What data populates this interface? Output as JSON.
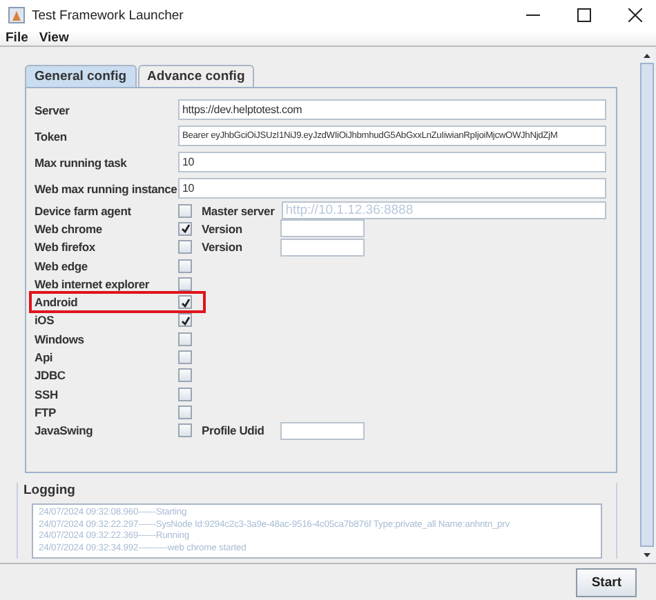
{
  "window": {
    "title": "Test Framework Launcher"
  },
  "menu": [
    "File",
    "View"
  ],
  "tabs": [
    {
      "label": "General config",
      "selected": true
    },
    {
      "label": "Advance config",
      "selected": false
    }
  ],
  "rows": [
    {
      "kind": "text",
      "label": "Server",
      "value": "https://dev.helptotest.com"
    },
    {
      "kind": "text",
      "label": "Token",
      "value": "Bearer eyJhbGciOiJSUzI1NiJ9.eyJzdWIiOiJhbmhudG5AbGxxLnZuIiwianRpIjoiMjcwOWJhNjdZjM"
    },
    {
      "kind": "text",
      "label": "Max running task",
      "value": "10"
    },
    {
      "kind": "text",
      "label": "Web max running instance",
      "value": "10"
    },
    {
      "kind": "check",
      "label": "Device farm agent",
      "checked": false,
      "highlighted": false,
      "extra_label": "Master server",
      "extra_field": {
        "placeholder": "http://10.1.12.36:8888",
        "wide": true
      }
    },
    {
      "kind": "check",
      "label": "Web chrome",
      "checked": true,
      "highlighted": false,
      "extra_label": "Version",
      "extra_field": {
        "wide": false
      }
    },
    {
      "kind": "check",
      "label": "Web firefox",
      "checked": false,
      "highlighted": false,
      "extra_label": "Version",
      "extra_field": {
        "wide": false
      }
    },
    {
      "kind": "check",
      "label": "Web edge",
      "checked": false,
      "highlighted": false
    },
    {
      "kind": "check",
      "label": "Web internet explorer",
      "checked": false,
      "highlighted": false
    },
    {
      "kind": "check",
      "label": "Android",
      "checked": true,
      "highlighted": true
    },
    {
      "kind": "check",
      "label": "iOS",
      "checked": true,
      "highlighted": false
    },
    {
      "kind": "check",
      "label": "Windows",
      "checked": false,
      "highlighted": false
    },
    {
      "kind": "check",
      "label": "Api",
      "checked": false,
      "highlighted": false
    },
    {
      "kind": "check",
      "label": "JDBC",
      "checked": false,
      "highlighted": false
    },
    {
      "kind": "check",
      "label": "SSH",
      "checked": false,
      "highlighted": false
    },
    {
      "kind": "check",
      "label": "FTP",
      "checked": false,
      "highlighted": false
    },
    {
      "kind": "check",
      "label": "JavaSwing",
      "checked": false,
      "highlighted": false,
      "extra_label": "Profile Udid",
      "extra_field": {
        "wide": false
      }
    }
  ],
  "logging": {
    "title": "Logging",
    "lines": [
      "24/07/2024 09:32:08.960------Starting",
      "24/07/2024 09:32:22.297------SysNode Id:9294c2c3-3a9e-48ac-9516-4c05ca7b876f Type:private_all Name:anhntn_prv",
      "24/07/2024 09:32:22.369------Running",
      "24/07/2024 09:32:34.992----------web chrome started"
    ]
  },
  "buttons": [
    "Start"
  ]
}
